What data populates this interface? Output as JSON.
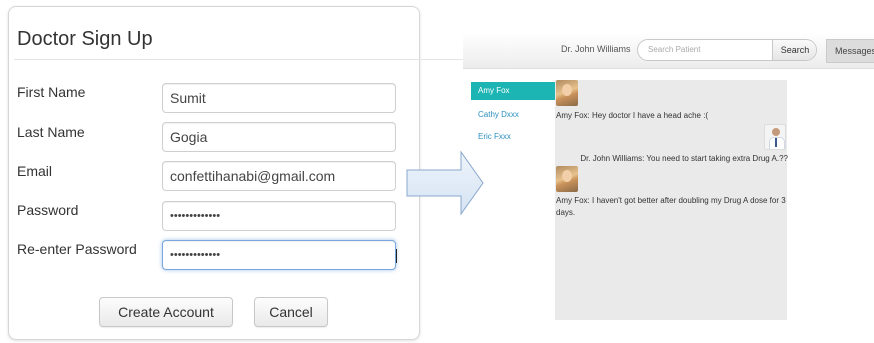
{
  "signup": {
    "title": "Doctor Sign Up",
    "fields": [
      {
        "label": "First Name",
        "value": "Sumit"
      },
      {
        "label": "Last Name",
        "value": "Gogia"
      },
      {
        "label": "Email",
        "value": "confettihanabi@gmail.com"
      },
      {
        "label": "Password",
        "value": "•••••••••••••"
      },
      {
        "label": "Re-enter Password",
        "value": "•••••••••••••"
      }
    ],
    "create_label": "Create Account",
    "cancel_label": "Cancel"
  },
  "arrow_icon": "right-arrow-icon",
  "messenger": {
    "doctor_name": "Dr. John Williams",
    "search_placeholder": "Search Patient",
    "search_label": "Search",
    "messages_tab": "Messages",
    "patients": [
      "Amy Fox",
      "Cathy Dxxx",
      "Eric Fxxx"
    ],
    "active_color": "#1db5b4",
    "chat": [
      {
        "sender": "Amy Fox",
        "text": "Amy Fox: Hey doctor I have a head ache :("
      },
      {
        "sender": "Dr. John Williams",
        "text": "Dr. John Williams: You need to start taking extra Drug A.??"
      },
      {
        "sender": "Amy Fox",
        "text": "Amy Fox: I haven't got better after doubling my Drug A dose for 3 days."
      }
    ]
  }
}
